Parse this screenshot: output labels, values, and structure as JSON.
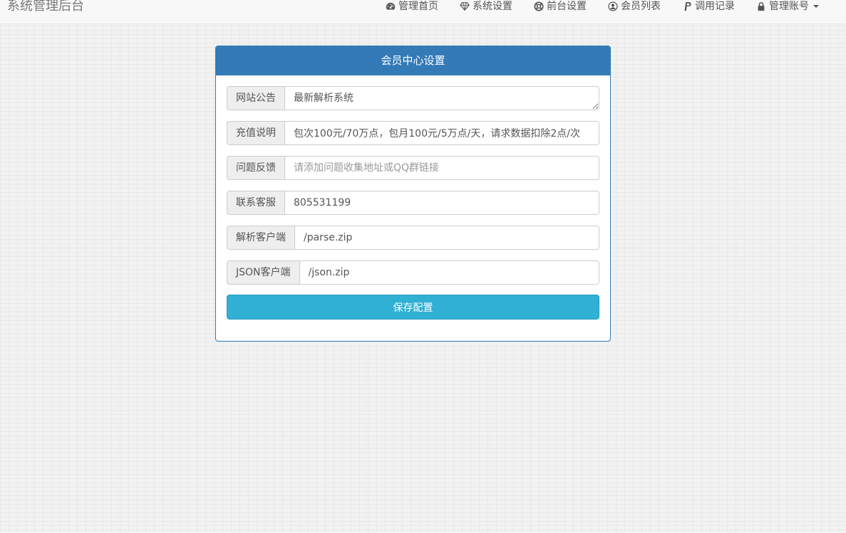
{
  "brand": "系统管理后台",
  "nav": {
    "items": [
      {
        "label": "管理首页",
        "icon": "dashboard-icon"
      },
      {
        "label": "系统设置",
        "icon": "diamond-icon"
      },
      {
        "label": "前台设置",
        "icon": "lifebuoy-icon"
      },
      {
        "label": "会员列表",
        "icon": "user-circle-icon"
      },
      {
        "label": "调用记录",
        "icon": "paypal-icon"
      },
      {
        "label": "管理账号",
        "icon": "lock-icon"
      }
    ]
  },
  "panel": {
    "title": "会员中心设置",
    "fields": [
      {
        "label": "网站公告",
        "value": "最新解析系统",
        "placeholder": ""
      },
      {
        "label": "充值说明",
        "value": "包次100元/70万点，包月100元/5万点/天，请求数据扣除2点/次",
        "placeholder": ""
      },
      {
        "label": "问题反馈",
        "value": "",
        "placeholder": "请添加问题收集地址或QQ群链接"
      },
      {
        "label": "联系客服",
        "value": "805531199",
        "placeholder": ""
      },
      {
        "label": "解析客户端",
        "value": "/parse.zip",
        "placeholder": ""
      },
      {
        "label": "JSON客户端",
        "value": "/json.zip",
        "placeholder": ""
      }
    ],
    "save_label": "保存配置"
  },
  "colors": {
    "primary": "#337ab7",
    "info": "#31b0d5",
    "addon_bg": "#eeeeee"
  }
}
